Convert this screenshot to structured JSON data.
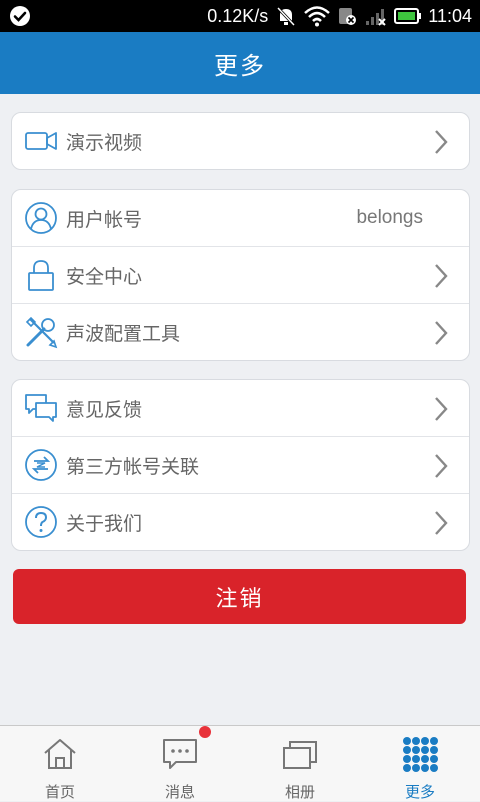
{
  "status_bar": {
    "speed": "0.12K/s",
    "time": "11:04"
  },
  "header": {
    "title": "更多"
  },
  "groups": [
    {
      "items": [
        {
          "icon": "video-camera-icon",
          "label": "演示视频"
        }
      ]
    },
    {
      "items": [
        {
          "icon": "user-icon",
          "label": "用户帐号",
          "value": "belongs"
        },
        {
          "icon": "lock-icon",
          "label": "安全中心"
        },
        {
          "icon": "tools-icon",
          "label": "声波配置工具"
        }
      ]
    },
    {
      "items": [
        {
          "icon": "feedback-chat-icon",
          "label": "意见反馈"
        },
        {
          "icon": "account-link-icon",
          "label": "第三方帐号关联"
        },
        {
          "icon": "help-question-icon",
          "label": "关于我们"
        }
      ]
    }
  ],
  "logout": {
    "label": "注销"
  },
  "bottom_nav": [
    {
      "icon": "home-icon",
      "label": "首页"
    },
    {
      "icon": "message-icon",
      "label": "消息"
    },
    {
      "icon": "album-icon",
      "label": "相册"
    },
    {
      "icon": "more-grid-icon",
      "label": "更多",
      "active": true
    }
  ],
  "colors": {
    "primary": "#1a7cc3",
    "danger": "#d9232a",
    "background": "#eef0f3"
  }
}
